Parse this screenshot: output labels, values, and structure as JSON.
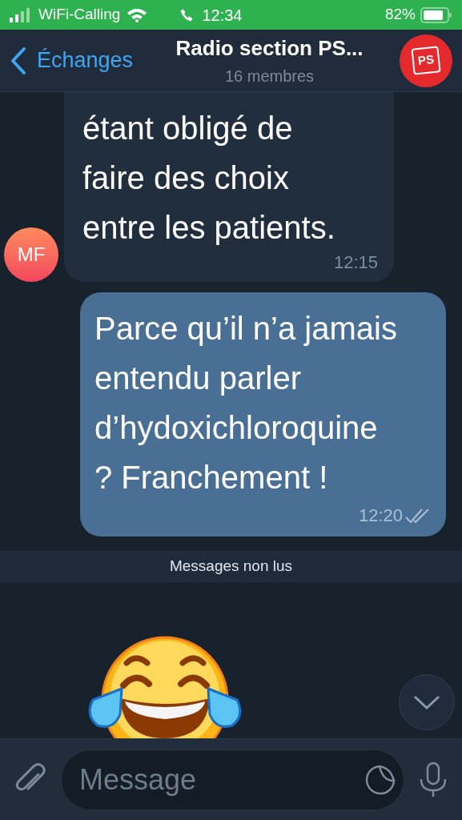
{
  "status_bar": {
    "carrier": "WiFi-Calling",
    "time": "12:34",
    "battery": "82%"
  },
  "header": {
    "back": "Échanges",
    "title": "Radio section PS...",
    "subtitle": "16 membres",
    "avatar_text": "PS"
  },
  "messages": [
    {
      "kind": "incoming",
      "text": "étant obligé de faire des choix entre les patients.",
      "time": "12:15",
      "avatar": "MF"
    },
    {
      "kind": "outgoing",
      "text": "Parce qu’il n’a jamais entendu parler d’hydoxichloroquine ? Franchement !",
      "time": "12:20",
      "read": true
    },
    {
      "kind": "divider",
      "text": "Messages non lus"
    },
    {
      "kind": "sticker"
    }
  ],
  "composer": {
    "placeholder": "Message"
  }
}
